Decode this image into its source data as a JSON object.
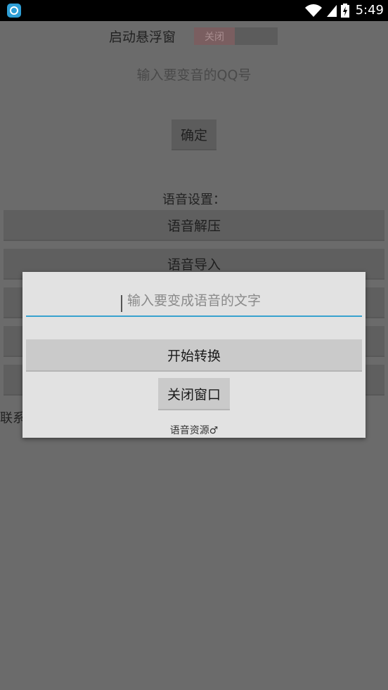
{
  "status_bar": {
    "time": "5:49",
    "icons": [
      "app-icon",
      "wifi-icon",
      "signal-icon",
      "battery-charging-icon"
    ]
  },
  "main": {
    "float_window_label": "启动悬浮窗",
    "float_switch_state": "关闭",
    "qq_input_placeholder": "输入要变音的QQ号",
    "confirm_label": "确定",
    "voice_settings_label": "语音设置：",
    "buttons": [
      "语音解压",
      "语音导入",
      "",
      "",
      ""
    ],
    "contact_text_partial": "联系"
  },
  "dialog": {
    "text_input_placeholder": "输入要变成语音的文字",
    "convert_label": "开始转换",
    "close_label": "关闭窗口",
    "source_link": "语音资源♂"
  },
  "colors": {
    "accent": "#37a2cf",
    "dim_background": "#6b6b6b",
    "dialog_background": "#e2e2e2"
  }
}
